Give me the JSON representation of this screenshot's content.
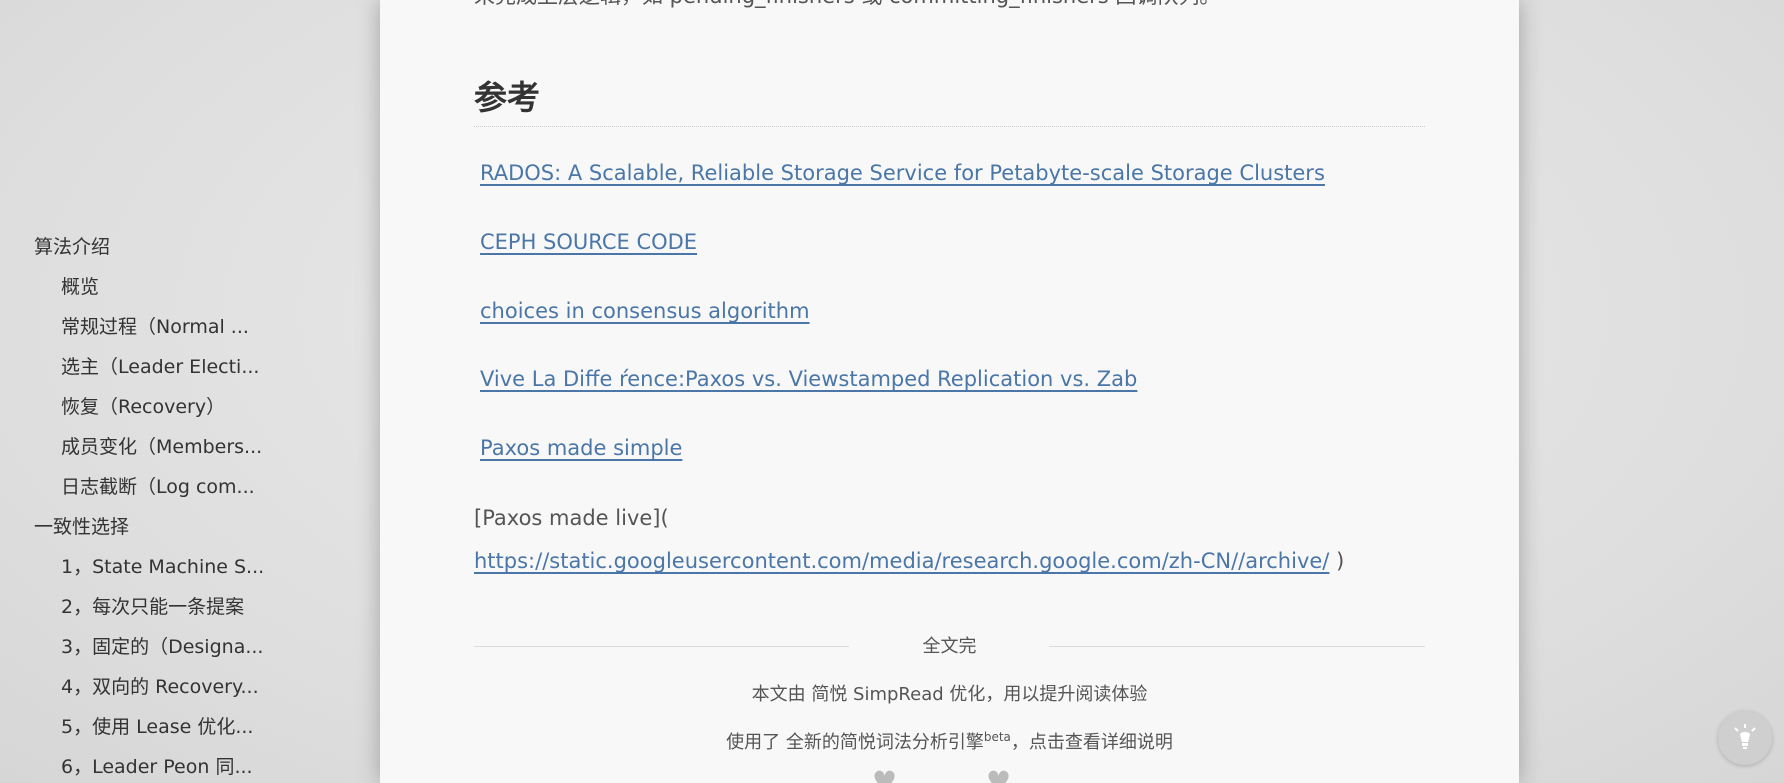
{
  "toc": {
    "items": [
      {
        "label": "算法介绍",
        "level": 1
      },
      {
        "label": "概览",
        "level": 2
      },
      {
        "label": "常规过程（Normal ...",
        "level": 2
      },
      {
        "label": "选主（Leader Electi...",
        "level": 2
      },
      {
        "label": "恢复（Recovery）",
        "level": 2
      },
      {
        "label": "成员变化（Members...",
        "level": 2
      },
      {
        "label": "日志截断（Log com...",
        "level": 2
      },
      {
        "label": "一致性选择",
        "level": 1
      },
      {
        "label": "1，State Machine S...",
        "level": 2
      },
      {
        "label": "2，每次只能一条提案",
        "level": 2
      },
      {
        "label": "3，固定的（Designa...",
        "level": 2
      },
      {
        "label": "4，双向的 Recovery...",
        "level": 2
      },
      {
        "label": "5，使用 Lease 优化...",
        "level": 2
      },
      {
        "label": "6，Leader Peon 同...",
        "level": 2
      }
    ]
  },
  "article": {
    "cut_line": "来完成上层逻辑，如 pending_finishers 或 committing_finishers 回调队列。",
    "section_heading": "参考",
    "references": [
      "RADOS: A Scalable, Reliable Storage Service for Petabyte-scale Storage Clusters",
      "CEPH SOURCE CODE",
      "choices in consensus algorithm",
      "Vive La Diffe ŕence:Paxos vs. Viewstamped Replication vs. Zab",
      "Paxos made simple"
    ],
    "live_prefix": "[Paxos made live](",
    "live_url": "https://static.googleusercontent.com/media/research.google.com/zh-CN//archive/",
    "live_suffix": ")",
    "end_text": "全文完",
    "footer": {
      "line1_prefix": "本文由 ",
      "line1_link": "简悦 SimpRead",
      "line1_suffix": " 优化，用以提升阅读体验",
      "line2_prefix": "使用了 ",
      "line2_link": "全新的简悦词法分析引擎",
      "line2_sup": "beta",
      "line2_mid": "，",
      "line2_link2": "点击查看详细说明"
    }
  },
  "fab": {
    "icon": "lightbulb-icon"
  }
}
